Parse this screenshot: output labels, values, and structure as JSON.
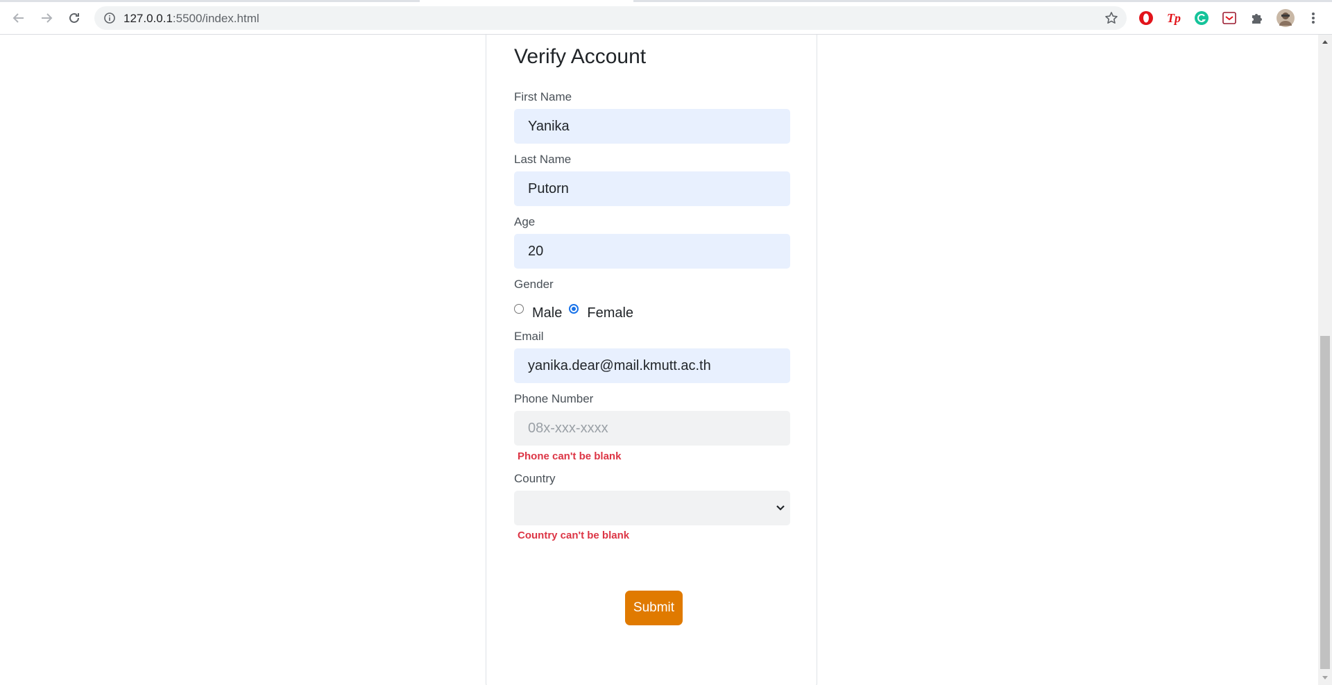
{
  "browser": {
    "url_host": "127.0.0.1",
    "url_path": ":5500/index.html",
    "back_icon": "back-arrow-icon",
    "forward_icon": "forward-arrow-icon",
    "reload_icon": "reload-icon",
    "info_icon": "info-icon",
    "bookmark_icon": "star-icon",
    "extensions": [
      "opera-icon",
      "tp-icon",
      "grammarly-icon",
      "pocket-icon",
      "puzzle-icon",
      "profile-avatar",
      "more-menu-icon"
    ],
    "tp_label": "Tp"
  },
  "form": {
    "title": "Verify Account",
    "first_name": {
      "label": "First Name",
      "value": "Yanika"
    },
    "last_name": {
      "label": "Last Name",
      "value": "Putorn"
    },
    "age": {
      "label": "Age",
      "value": "20"
    },
    "gender": {
      "label": "Gender",
      "options": [
        "Male",
        "Female"
      ],
      "selected": "Female"
    },
    "email": {
      "label": "Email",
      "value": "yanika.dear@mail.kmutt.ac.th"
    },
    "phone": {
      "label": "Phone Number",
      "value": "",
      "placeholder": "08x-xxx-xxxx",
      "error": "Phone can't be blank"
    },
    "country": {
      "label": "Country",
      "value": "",
      "error": "Country can't be blank"
    },
    "submit_label": "Submit"
  },
  "colors": {
    "submit_bg": "#e07a00",
    "error": "#dc3545",
    "autofill_bg": "#e8f0fe",
    "radio_checked": "#1a73e8"
  }
}
